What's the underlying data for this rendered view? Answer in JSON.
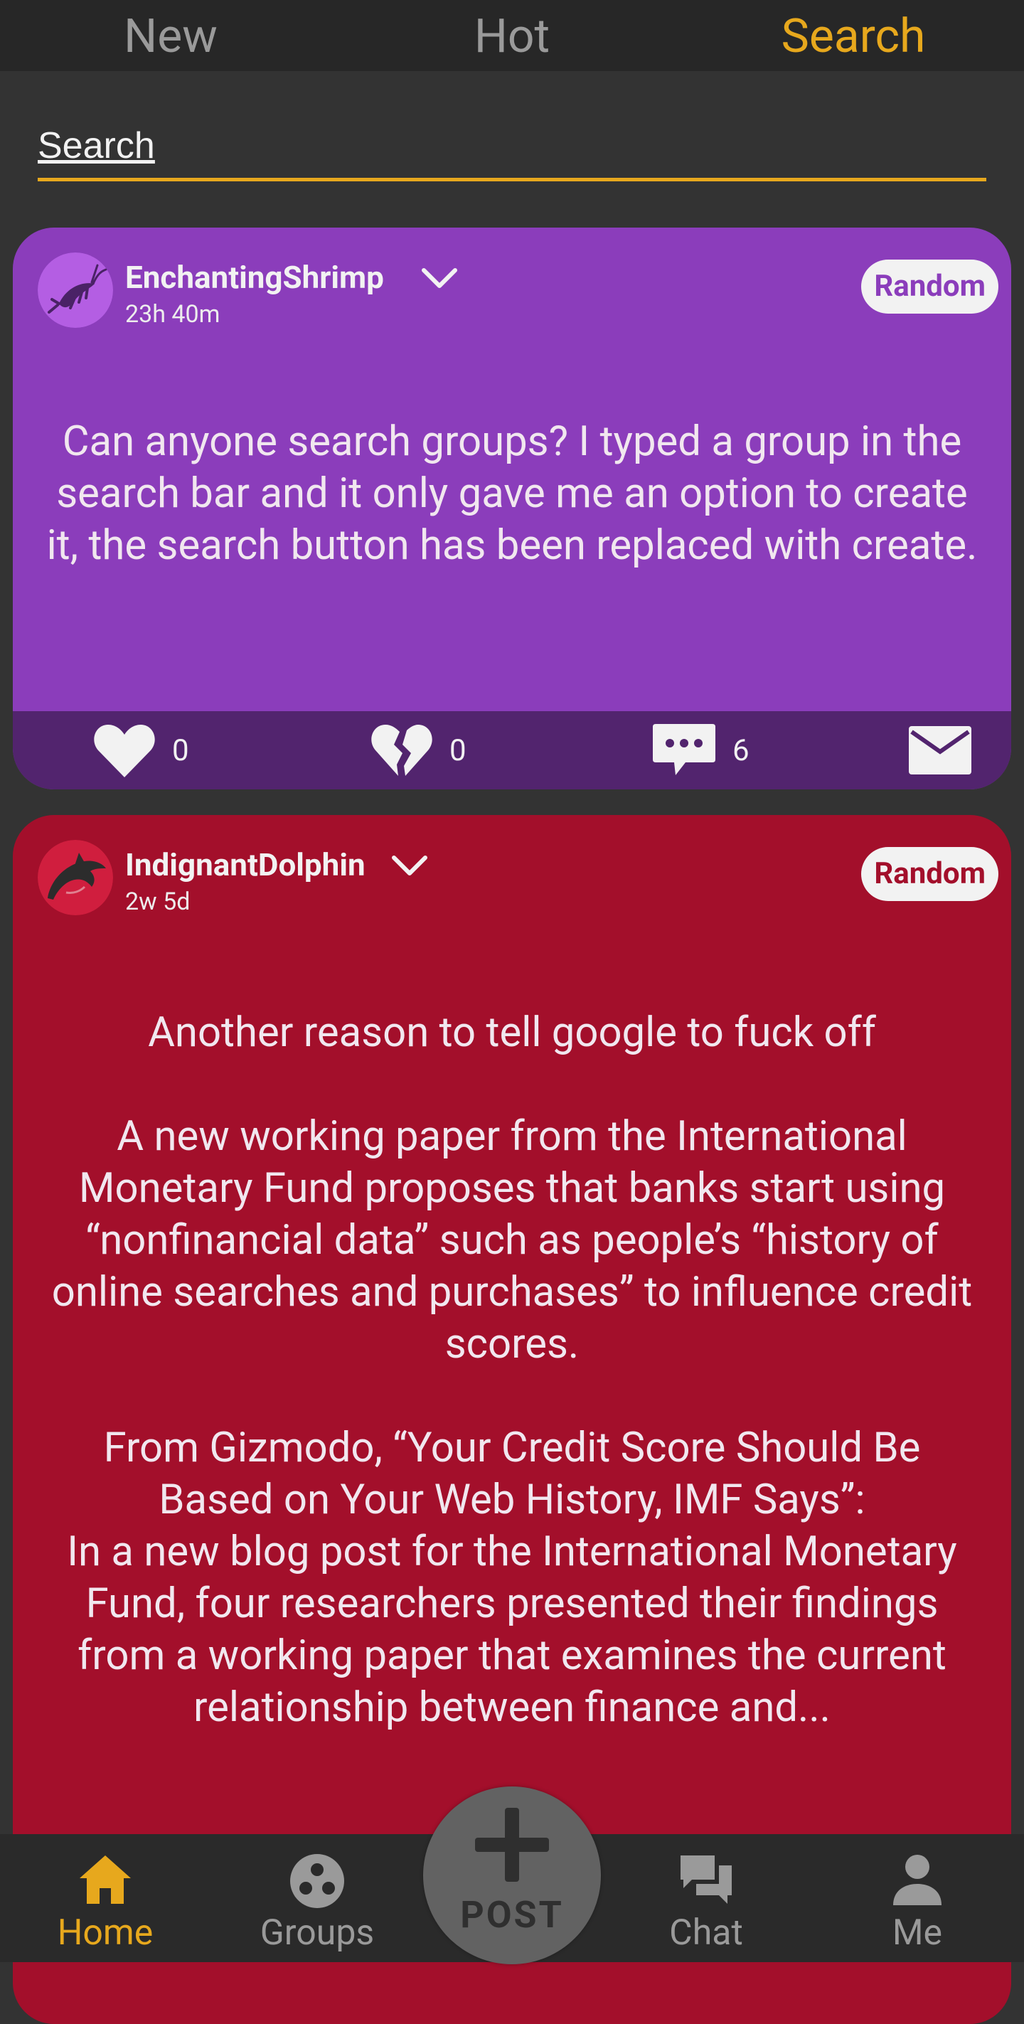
{
  "top_tabs": [
    {
      "label": "New"
    },
    {
      "label": "Hot"
    },
    {
      "label": "Search"
    }
  ],
  "search": {
    "placeholder": "Search"
  },
  "posts": [
    {
      "username": "EnchantingShrimp",
      "time": "23h 40m",
      "badge": "Random",
      "color": "#8b3dbb",
      "text": "Can anyone search groups? I typed a group in the search bar and it only gave me an option to create it, the search button has been replaced with create.",
      "likes": "0",
      "dislikes": "0",
      "comments": "6",
      "avatar_icon": "shrimp-icon"
    },
    {
      "username": "IndignantDolphin",
      "time": "2w 5d",
      "badge": "Random",
      "color": "#a30f2b",
      "text": "Another reason to tell google to fuck off\n\nA new working paper from the International Monetary Fund proposes that banks start using “nonfinancial data” such as people’s “history of online searches and purchases” to influence credit scores.\n\nFrom Gizmodo, “Your Credit Score Should Be Based on Your Web History, IMF Says”:\nIn a new blog post for the International Monetary Fund, four researchers presented their findings from a working paper that examines the current relationship between finance and...",
      "avatar_icon": "dolphin-icon"
    }
  ],
  "bottom_nav": {
    "home": "Home",
    "groups": "Groups",
    "post": "POST",
    "chat": "Chat",
    "me": "Me"
  },
  "colors": {
    "accent": "#e7a81d",
    "background": "#333333",
    "purple_card": "#8b3dbb",
    "red_card": "#a30f2b"
  }
}
